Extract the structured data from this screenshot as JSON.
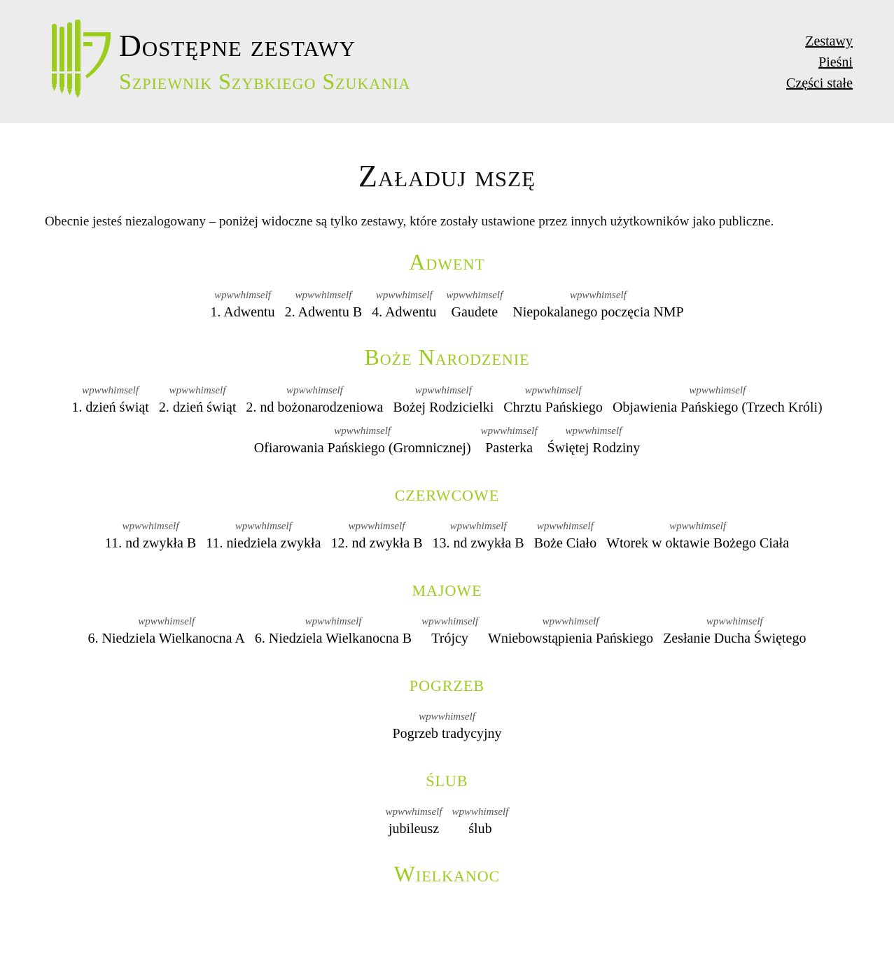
{
  "header": {
    "title": "Dostępne zestawy",
    "subtitle": "Szpiewnik Szybkiego Szukania",
    "logo_icon": "organ-pipes-icon",
    "accent_color": "#9ccc1e",
    "nav": [
      "Zestawy",
      "Pieśni",
      "Części stałe"
    ]
  },
  "main": {
    "title": "Załaduj mszę",
    "notice": "Obecnie jesteś niezalogowany – poniżej widoczne są tylko zestawy, które zostały ustawione przez innych użytkowników jako publiczne."
  },
  "sections": [
    {
      "title": "Adwent",
      "sets": [
        {
          "author": "wpwwhimself",
          "name": "1. Adwentu"
        },
        {
          "author": "wpwwhimself",
          "name": "2. Adwentu B"
        },
        {
          "author": "wpwwhimself",
          "name": "4. Adwentu"
        },
        {
          "author": "wpwwhimself",
          "name": "Gaudete"
        },
        {
          "author": "wpwwhimself",
          "name": "Niepokalanego poczęcia NMP"
        }
      ]
    },
    {
      "title": "Boże Narodzenie",
      "sets": [
        {
          "author": "wpwwhimself",
          "name": "1. dzień świąt"
        },
        {
          "author": "wpwwhimself",
          "name": "2. dzień świąt"
        },
        {
          "author": "wpwwhimself",
          "name": "2. nd bożonarodzeniowa"
        },
        {
          "author": "wpwwhimself",
          "name": "Bożej Rodzicielki"
        },
        {
          "author": "wpwwhimself",
          "name": "Chrztu Pańskiego"
        },
        {
          "author": "wpwwhimself",
          "name": "Objawienia Pańskiego (Trzech Króli)"
        },
        {
          "author": "wpwwhimself",
          "name": "Ofiarowania Pańskiego (Gromnicznej)"
        },
        {
          "author": "wpwwhimself",
          "name": "Pasterka"
        },
        {
          "author": "wpwwhimself",
          "name": "Świętej Rodziny"
        }
      ]
    },
    {
      "title": "czerwcowe",
      "sets": [
        {
          "author": "wpwwhimself",
          "name": "11. nd zwykła B"
        },
        {
          "author": "wpwwhimself",
          "name": "11. niedziela zwykła"
        },
        {
          "author": "wpwwhimself",
          "name": "12. nd zwykła B"
        },
        {
          "author": "wpwwhimself",
          "name": "13. nd zwykła B"
        },
        {
          "author": "wpwwhimself",
          "name": "Boże Ciało"
        },
        {
          "author": "wpwwhimself",
          "name": "Wtorek w oktawie Bożego Ciała"
        }
      ]
    },
    {
      "title": "majowe",
      "sets": [
        {
          "author": "wpwwhimself",
          "name": "6. Niedziela Wielkanocna A"
        },
        {
          "author": "wpwwhimself",
          "name": "6. Niedziela Wielkanocna B"
        },
        {
          "author": "wpwwhimself",
          "name": "Trójcy"
        },
        {
          "author": "wpwwhimself",
          "name": "Wniebowstąpienia Pańskiego"
        },
        {
          "author": "wpwwhimself",
          "name": "Zesłanie Ducha Świętego"
        }
      ]
    },
    {
      "title": "pogrzeb",
      "sets": [
        {
          "author": "wpwwhimself",
          "name": "Pogrzeb tradycyjny"
        }
      ]
    },
    {
      "title": "ślub",
      "sets": [
        {
          "author": "wpwwhimself",
          "name": "jubileusz"
        },
        {
          "author": "wpwwhimself",
          "name": "ślub"
        }
      ]
    },
    {
      "title": "Wielkanoc",
      "sets": []
    }
  ]
}
